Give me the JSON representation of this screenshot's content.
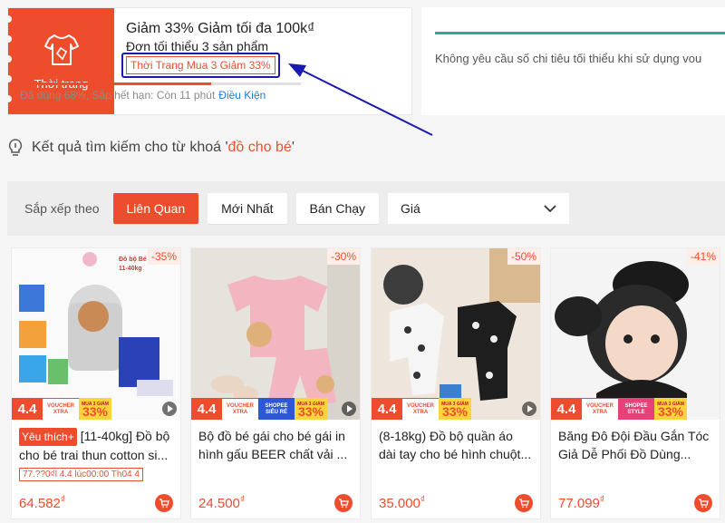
{
  "voucher": {
    "category": "Thời trang",
    "title": "Giảm 33% Giảm tối đa 100k₫",
    "min_order": "Đơn tối thiểu 3 sản phẩm",
    "tag": "Thời Trang Mua 3 Giảm 33%",
    "used_fraction": 0.68,
    "meta": "Đã dùng 68%, Sắp hết hạn: Còn 11 phút",
    "terms_link": "Điều Kiện"
  },
  "voucher2": {
    "text": "Không yêu cầu số chi tiêu tối thiểu khi sử dụng vou"
  },
  "search": {
    "prefix": "Kết quả tìm kiếm cho từ khoá '",
    "keyword": "đồ cho bé",
    "suffix": "'"
  },
  "sort": {
    "label": "Sắp xếp theo",
    "relevance": "Liên Quan",
    "newest": "Mới Nhất",
    "bestselling": "Bán Chạy",
    "price": "Giá"
  },
  "promo_strip": {
    "event": "4.4",
    "voucher_line1": "VOUCHER",
    "voucher_line2": "XTRA",
    "shopee_line1": "SHOPEE",
    "shopee_line2": "SIÊU RẺ",
    "shopee_style_line1": "SHOPEE",
    "shopee_style_line2": "STYLE",
    "mua3": "MUA 3 GIẢM",
    "pct": "33%"
  },
  "products": [
    {
      "discount": "-35%",
      "badge": "Yêu thích+",
      "name": "[11-40kg] Đồ bộ cho bé trai thun cotton si...",
      "promo": "77.??0₫l 4.4 lúc00:00 Th04 4",
      "price": "64.582",
      "thumb_label": "Đồ bộ Bé 1 11-40kg"
    },
    {
      "discount": "-30%",
      "name": "Bộ đồ bé gái cho bé gái in hình gấu BEER chất vải ...",
      "price": "24.500"
    },
    {
      "discount": "-50%",
      "name": "(8-18kg) Đồ bộ quần áo dài tay cho bé hình chuột...",
      "price": "35.000"
    },
    {
      "discount": "-41%",
      "name": "Băng Đô Đội Đầu Gắn Tóc Giả Dễ Phối Đồ Dùng...",
      "price": "77.099"
    }
  ],
  "currency": "₫"
}
